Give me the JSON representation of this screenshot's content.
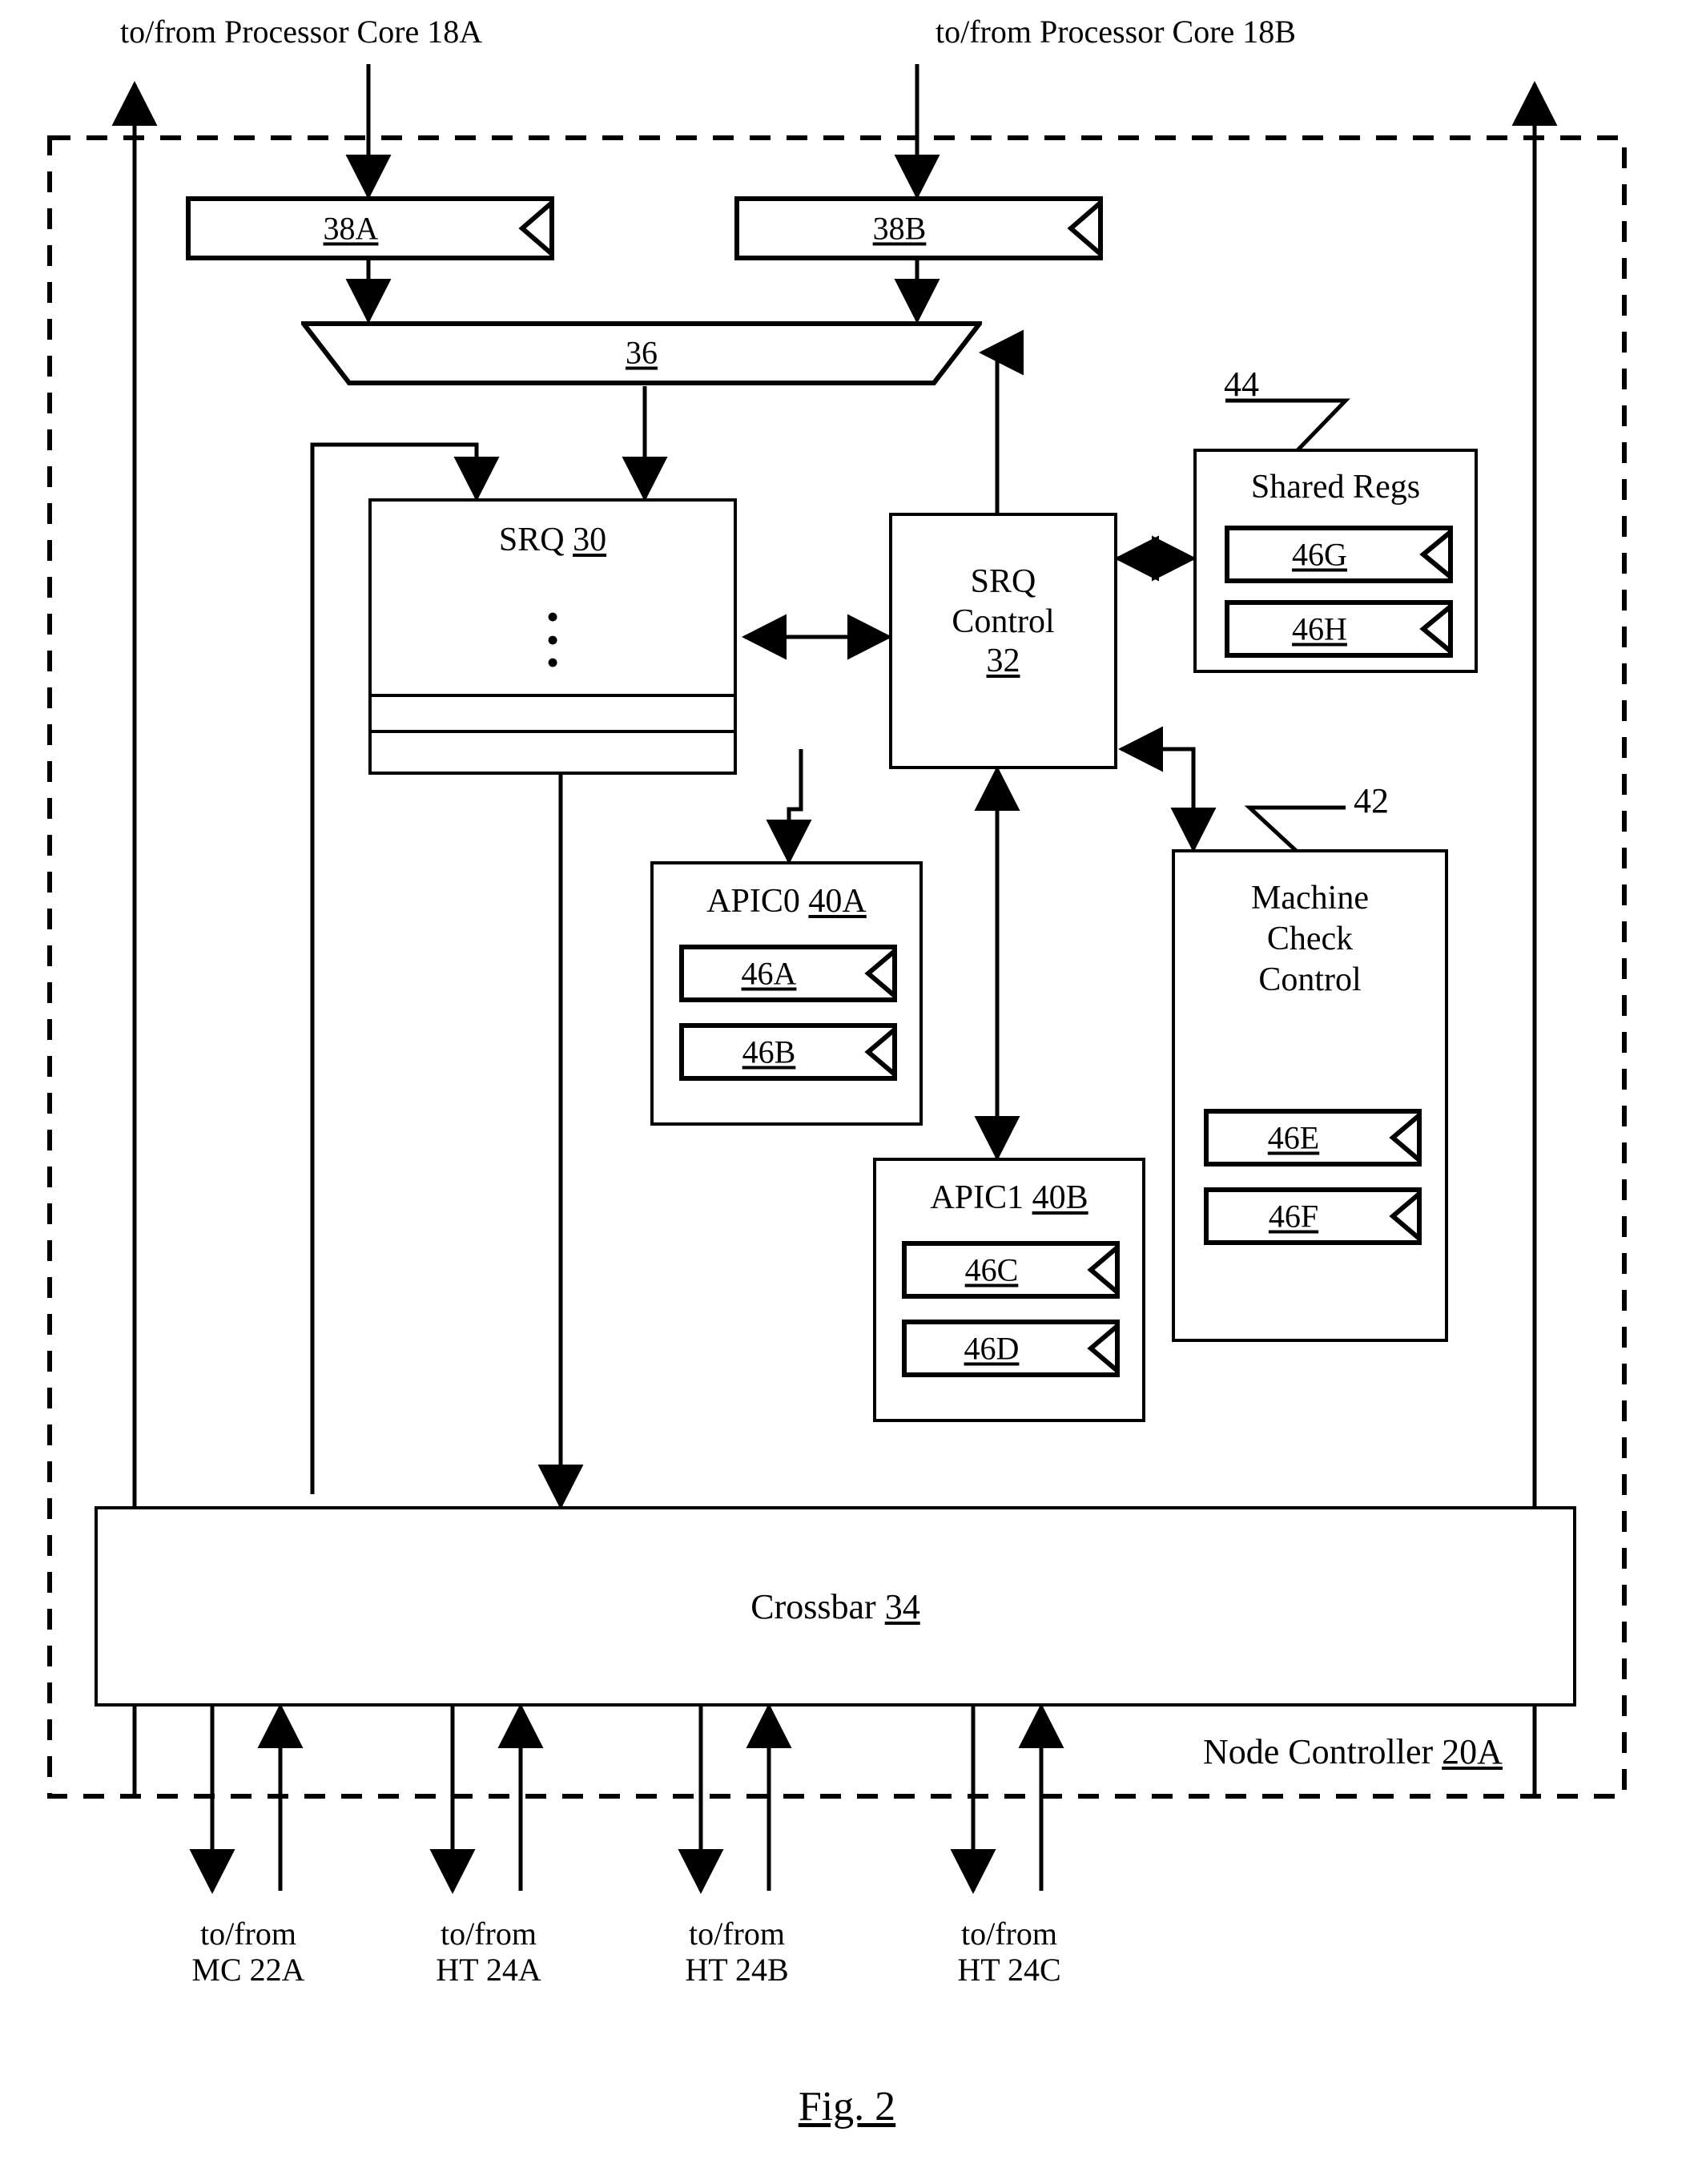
{
  "figure": {
    "caption": "Fig. 2"
  },
  "external_top": [
    {
      "name": "proc-core-18a",
      "text": "to/from Processor Core 18A"
    },
    {
      "name": "proc-core-18b",
      "text": "to/from Processor Core 18B"
    }
  ],
  "external_bottom": [
    {
      "name": "mc-22a",
      "line1": "to/from",
      "line2": "MC 22A"
    },
    {
      "name": "ht-24a",
      "line1": "to/from",
      "line2": "HT 24A"
    },
    {
      "name": "ht-24b",
      "line1": "to/from",
      "line2": "HT 24B"
    },
    {
      "name": "ht-24c",
      "line1": "to/from",
      "line2": "HT 24C"
    }
  ],
  "enclosure": {
    "label_text": "Node Controller ",
    "label_ref": "20A"
  },
  "blocks": {
    "buffer_a": {
      "label": "38A"
    },
    "buffer_b": {
      "label": "38B"
    },
    "mux": {
      "label": "36"
    },
    "srq": {
      "label_text": "SRQ ",
      "label_ref": "30",
      "dots": "•\n•\n•"
    },
    "srq_control": {
      "line1": "SRQ",
      "line2": "Control",
      "ref": "32"
    },
    "shared_regs": {
      "title": "Shared Regs",
      "callout": "44",
      "registers": [
        {
          "label": "46G"
        },
        {
          "label": "46H"
        }
      ]
    },
    "apic0": {
      "title_text": "APIC0 ",
      "title_ref": "40A",
      "registers": [
        {
          "label": "46A"
        },
        {
          "label": "46B"
        }
      ]
    },
    "apic1": {
      "title_text": "APIC1 ",
      "title_ref": "40B",
      "registers": [
        {
          "label": "46C"
        },
        {
          "label": "46D"
        }
      ]
    },
    "machine_check": {
      "line1": "Machine",
      "line2": "Check",
      "line3": "Control",
      "callout": "42",
      "registers": [
        {
          "label": "46E"
        },
        {
          "label": "46F"
        }
      ]
    },
    "crossbar": {
      "label_text": "Crossbar ",
      "label_ref": "34"
    }
  },
  "colors": {
    "ink": "#000000",
    "paper": "#ffffff"
  }
}
